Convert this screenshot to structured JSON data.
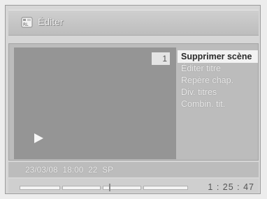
{
  "window": {
    "title": "Éditer",
    "title_icon": "edit-film-icon"
  },
  "preview": {
    "scene_number": "1",
    "play_icon": "play-icon"
  },
  "menu": {
    "items": [
      {
        "label": "Supprimer scène",
        "selected": true
      },
      {
        "label": "Éditer titre",
        "selected": false
      },
      {
        "label": "Repère chap.",
        "selected": false
      },
      {
        "label": "Div. titres",
        "selected": false
      },
      {
        "label": "Combin. tit.",
        "selected": false
      }
    ]
  },
  "info": {
    "date": "23/03/08",
    "time": "18:00",
    "channel": "22",
    "mode": "SP"
  },
  "playback": {
    "timecode": "1 : 25 : 47",
    "chapter_count": 4
  },
  "colors": {
    "background": "#d6d6d6",
    "selected_bg": "#f2f2f2"
  }
}
